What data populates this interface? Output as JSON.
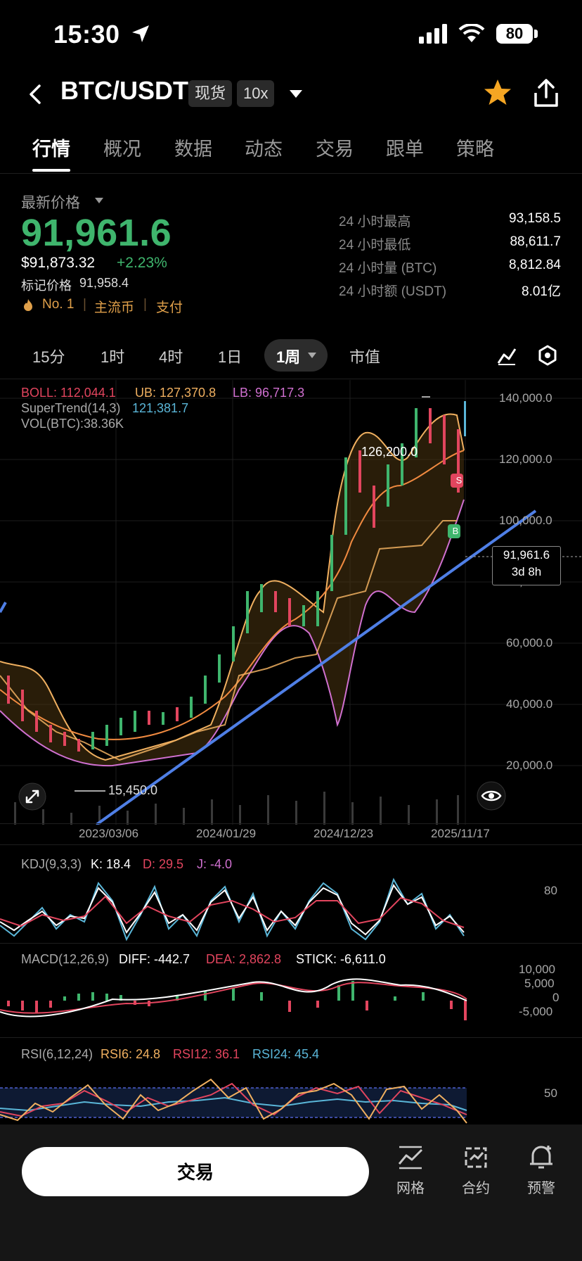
{
  "status_bar": {
    "time": "15:30",
    "battery": "80"
  },
  "header": {
    "pair": "BTC/USDT",
    "tag_spot": "现货",
    "tag_leverage": "10x"
  },
  "tabs": [
    "行情",
    "概况",
    "数据",
    "动态",
    "交易",
    "跟单",
    "策略"
  ],
  "price": {
    "label": "最新价格",
    "last": "91,961.6",
    "usd": "$91,873.32",
    "change": "+2.23%",
    "mark_label": "标记价格",
    "mark": "91,958.4",
    "tags": [
      "No. 1",
      "主流币",
      "支付"
    ]
  },
  "stats": [
    {
      "label": "24 小时最高",
      "value": "93,158.5"
    },
    {
      "label": "24 小时最低",
      "value": "88,611.7"
    },
    {
      "label": "24 小时量 (BTC)",
      "value": "8,812.84"
    },
    {
      "label": "24 小时额 (USDT)",
      "value": "8.01亿"
    }
  ],
  "intervals": [
    "15分",
    "1时",
    "4时",
    "1日",
    "1周",
    "市值"
  ],
  "indicators": {
    "boll_label": "BOLL: 112,044.1",
    "ub": "UB: 127,370.8",
    "lb": "LB: 96,717.3",
    "supertrend_label": "SuperTrend(14,3)",
    "supertrend": "121,381.7",
    "vol": "VOL(BTC):38.36K",
    "kdj_label": "KDJ(9,3,3)",
    "kdj_k": "K: 18.4",
    "kdj_d": "D: 29.5",
    "kdj_j": "J: -4.0",
    "macd_label": "MACD(12,26,9)",
    "macd_diff": "DIFF: -442.7",
    "macd_dea": "DEA: 2,862.8",
    "macd_stick": "STICK: -6,611.0",
    "rsi_label": "RSI(6,12,24)",
    "rsi6": "RSI6: 24.8",
    "rsi12": "RSI12: 36.1",
    "rsi24": "RSI24: 45.4"
  },
  "chart_annotations": {
    "high": "126,200.0",
    "low": "15,450.0",
    "price_tag": "91,961.6",
    "countdown": "3d 8h",
    "sell": "S",
    "buy": "B"
  },
  "chart_data": {
    "type": "candlestick",
    "y_ticks": [
      "140,000.0",
      "120,000.0",
      "100,000.0",
      "80,000.0",
      "60,000.0",
      "40,000.0",
      "20,000.0"
    ],
    "x_ticks": [
      "2023/03/06",
      "2024/01/29",
      "2024/12/23",
      "2025/11/17"
    ],
    "kdj_tick": "80",
    "macd_ticks": [
      "10,000",
      "5,000",
      "0",
      "-5,000"
    ],
    "rsi_tick": "50",
    "close_path": [
      [
        2022.6,
        42000
      ],
      [
        2022.75,
        24000
      ],
      [
        2022.9,
        19000
      ],
      [
        2023.0,
        16500
      ],
      [
        2023.1,
        22000
      ],
      [
        2023.3,
        28000
      ],
      [
        2023.6,
        29500
      ],
      [
        2023.8,
        26000
      ],
      [
        2023.9,
        37000
      ],
      [
        2024.0,
        43000
      ],
      [
        2024.15,
        52000
      ],
      [
        2024.25,
        68000
      ],
      [
        2024.5,
        62000
      ],
      [
        2024.7,
        57000
      ],
      [
        2024.85,
        67000
      ],
      [
        2024.9,
        90000
      ],
      [
        2025.0,
        95000
      ],
      [
        2025.1,
        97000
      ],
      [
        2025.25,
        82000
      ],
      [
        2025.4,
        94000
      ],
      [
        2025.55,
        109000
      ],
      [
        2025.75,
        120000
      ],
      [
        2025.85,
        112000
      ],
      [
        2025.92,
        96000
      ],
      [
        2025.98,
        91961.6
      ]
    ],
    "ylim": [
      0,
      150000
    ]
  },
  "bottom_nav": {
    "trade": "交易",
    "items": [
      "网格",
      "合约",
      "预警"
    ]
  },
  "colors": {
    "up": "#3fb56d",
    "down": "#e2455e",
    "accent": "#e0a04a",
    "trendline": "#4f7fe6"
  }
}
